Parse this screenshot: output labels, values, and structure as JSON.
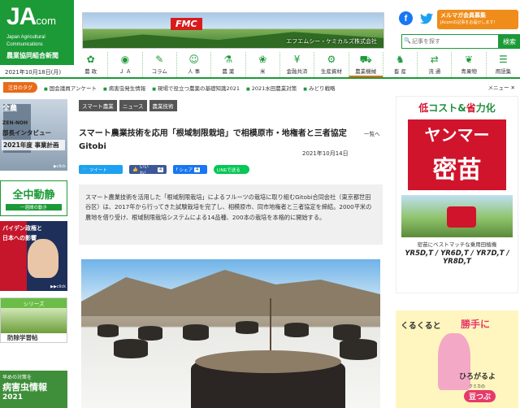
{
  "site": {
    "logo_main": "JA",
    "logo_suffix": "com",
    "logo_sub1": "Japan Agricultural",
    "logo_sub2": "Communications",
    "newspaper": "農業協同組合新聞",
    "date": "2021年10月18日(月)"
  },
  "top_banner": {
    "brand": "FMC",
    "company": "エフエムシー・ケミカルズ株式会社"
  },
  "social": {
    "facebook": "f",
    "twitter": "🐦"
  },
  "mail_banner": {
    "title": "メルマガ会員募集",
    "sub": "JAcomの記事をお届けします！"
  },
  "search": {
    "placeholder": "記事を探す",
    "button": "検索"
  },
  "categories": [
    {
      "label": "農 政",
      "icon": "✿"
    },
    {
      "label": "Ｊ Ａ",
      "icon": "◉"
    },
    {
      "label": "コラム",
      "icon": "✎"
    },
    {
      "label": "人 事",
      "icon": "☺"
    },
    {
      "label": "農 薬",
      "icon": "⚗"
    },
    {
      "label": "米",
      "icon": "❀"
    },
    {
      "label": "金融共済",
      "icon": "¥"
    },
    {
      "label": "生産資材",
      "icon": "⚙"
    },
    {
      "label": "農業機械",
      "icon": "⛟"
    },
    {
      "label": "畜 産",
      "icon": "♞"
    },
    {
      "label": "流 通",
      "icon": "⇄"
    },
    {
      "label": "青果物",
      "icon": "❦"
    },
    {
      "label": "用語集",
      "icon": "☰"
    }
  ],
  "tags_bar": {
    "label": "注目のタグ",
    "tags": [
      "国会議員アンケート",
      "病害虫発生情報",
      "現場で役立つ農薬の基礎知識2021",
      "2021水田農業対策",
      "みどり戦略"
    ],
    "menu": "メニュー ✕"
  },
  "left_ads": {
    "ad1_l1": "全農",
    "ad1_l2": "ZEN-NOH",
    "ad1_l3": "部長インタビュー",
    "ad1_l4": "2021年度 事業計画",
    "ad1_click": "▶click",
    "ad2_big": "全中動静",
    "ad2_sub": "一週間の動き",
    "ad3_l1": "バイデン政権と",
    "ad3_l2": "日本への影響",
    "ad3_click": "▶▶click",
    "ad4_head": "シリーズ",
    "ad4_title": "防除学習帖",
    "ad5_l1": "早めの対策を",
    "ad5_l2": "病害虫情報",
    "ad5_l3": "2021"
  },
  "breadcrumbs": [
    "スマート農業",
    "ニュース",
    "農業技術"
  ],
  "article": {
    "title": "スマート農業技術を応用「根域制限栽培」で相模原市・地権者と三者協定　Gitobi",
    "list_link": "一覧へ",
    "date": "2021年10月14日",
    "summary": "スマート農業技術を活用した「根域制限栽培」によるフルーツの栽培に取り組むGitobi合同会社（東京都世田谷区）は、2017年から行ってきた試験栽培を完了し、相模原市、同市地権者と三者協定を締結。2000平米の農地を借り受け、根域制限栽培システムによる14品種、200本の栽培を本格的に開始する。"
  },
  "share": {
    "tweet": "ツイート",
    "like": "いいね！",
    "like_count": "4",
    "fb_share": "シェア",
    "fb_count": "4",
    "line": "LINEで送る"
  },
  "right_ads": {
    "ad1_slogan_a": "低",
    "ad1_slogan_b": "コスト&",
    "ad1_slogan_c": "省",
    "ad1_slogan_d": "力化",
    "ad1_maker": "ヤンマー",
    "ad1_product": "密苗",
    "ad1_caption": "密苗にベストマッチな乗用田植機",
    "ad1_models": "YR5D,T / YR6D,T / YR7D,T / YR8D,T",
    "ad2_t1": "くるくると",
    "ad2_t2": "勝手に",
    "ad2_t3": "ひろがるよ",
    "ad2_sub": "クミカの",
    "ad2_logo": "豆つぶ"
  }
}
